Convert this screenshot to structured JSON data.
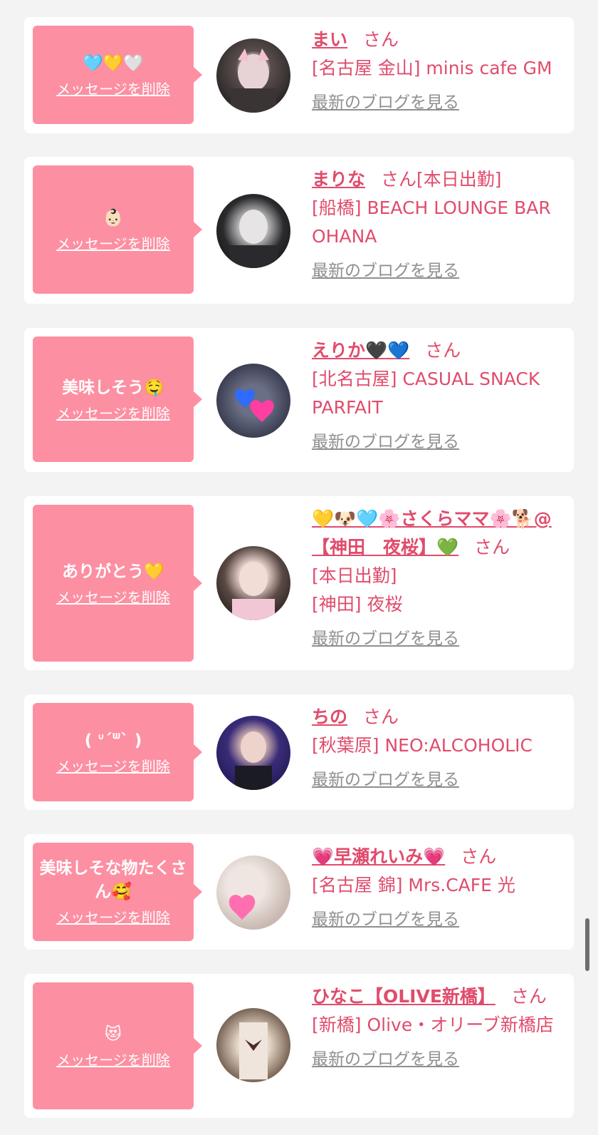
{
  "delete_label": "メッセージを削除",
  "san_label": "さん",
  "blog_label": "最新のブログを見る",
  "cards": [
    {
      "message": "🩵💛🤍",
      "name": "まい",
      "attendance": "",
      "shop": "[名古屋 金山] minis cafe GM",
      "avatar_icon": "avatar-photo"
    },
    {
      "message": "👶🏻",
      "name": "まりな",
      "attendance": "[本日出勤]",
      "shop": "[船橋] BEACH LOUNGE BAR OHANA",
      "avatar_icon": "avatar-photo"
    },
    {
      "message": "美味しそう🤤",
      "name": "えりか🖤💙",
      "attendance": "",
      "shop": "[北名古屋] CASUAL SNACK PARFAIT",
      "avatar_icon": "avatar-photo"
    },
    {
      "message": "ありがとう💛",
      "name": "💛🐶🩵🌸さくらママ🌸🐕@【神田　夜桜】💚",
      "attendance": "[本日出勤]",
      "shop": "[神田] 夜桜",
      "avatar_icon": "avatar-photo"
    },
    {
      "message": "(  ᐡ´ᐜ` )",
      "name": "ちの",
      "attendance": "",
      "shop": "[秋葉原] NEO:ALCOHOLIC",
      "avatar_icon": "avatar-photo"
    },
    {
      "message": "美味しそな物たくさん🥰",
      "name": "💗早瀬れいみ💗",
      "attendance": "",
      "shop": "[名古屋 錦] Mrs.CAFE 光",
      "avatar_icon": "avatar-photo"
    },
    {
      "message": "😻",
      "name": "ひなこ【OLIVE新橋】",
      "attendance": "",
      "shop": "[新橋] Olive・オリーブ新橋店",
      "avatar_icon": "avatar-photo"
    }
  ],
  "colors": {
    "page_bg": "#f4f3f3",
    "bubble_bg": "#fd8fa2",
    "accent_text": "#e04c6c",
    "muted_link": "#8f8f8f"
  }
}
